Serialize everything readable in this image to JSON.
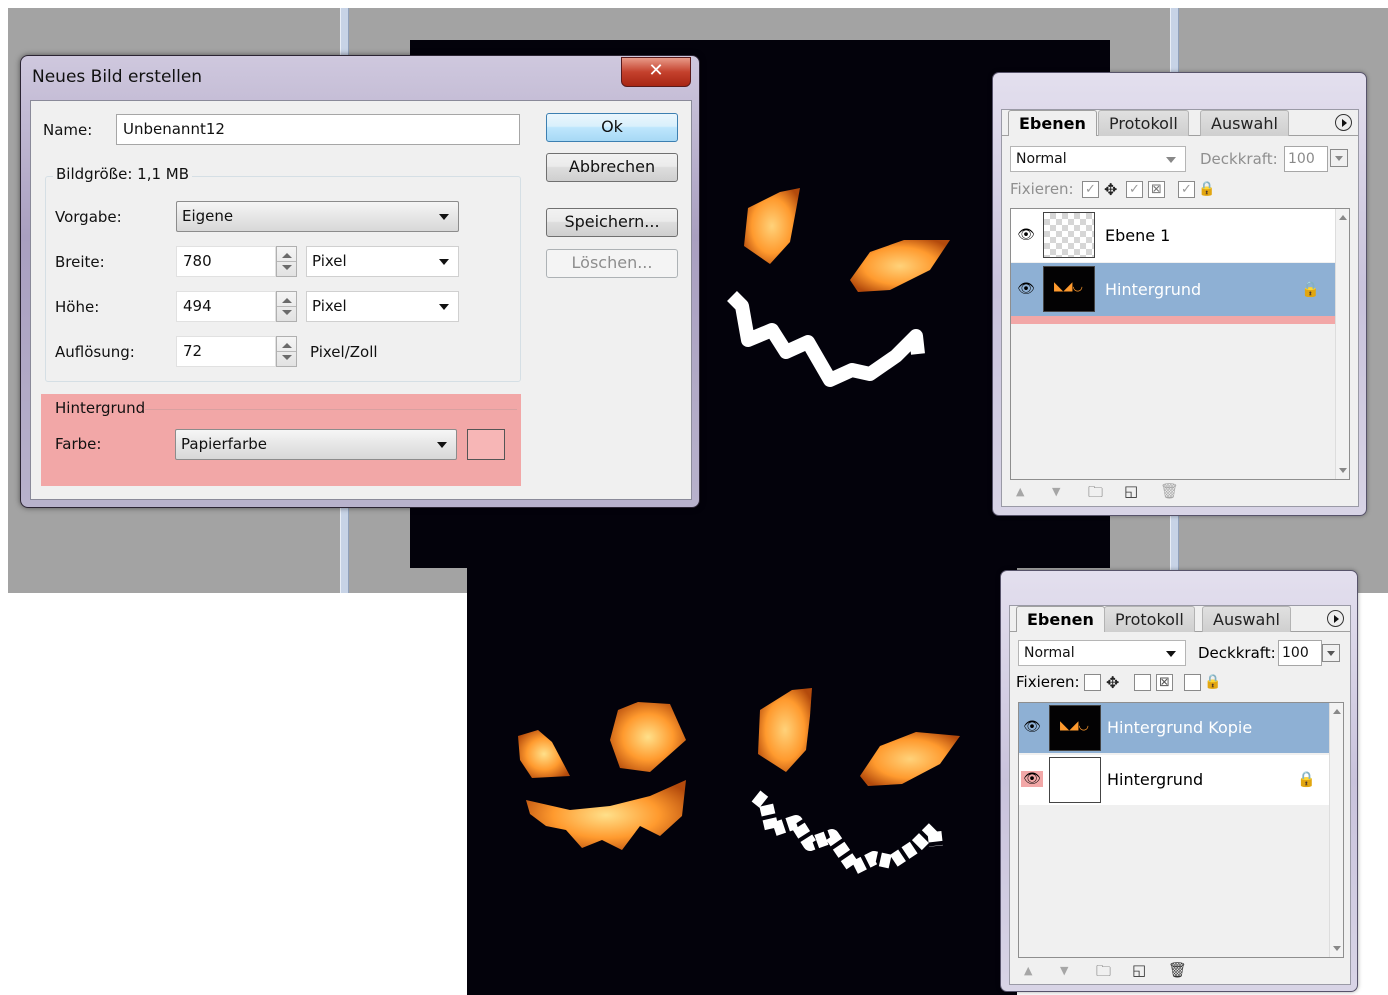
{
  "dialog": {
    "title": "Neues Bild erstellen",
    "close_glyph": "✕",
    "name_label": "Name:",
    "name_value": "Unbenannt12",
    "bildgroesse_label": "Bildgröße: 1,1 MB",
    "vorgabe_label": "Vorgabe:",
    "vorgabe_value": "Eigene",
    "breite_label": "Breite:",
    "breite_value": "780",
    "breite_unit": "Pixel",
    "hoehe_label": "Höhe:",
    "hoehe_value": "494",
    "hoehe_unit": "Pixel",
    "aufloesung_label": "Auflösung:",
    "aufloesung_value": "72",
    "aufloesung_unit": "Pixel/Zoll",
    "hintergrund_label": "Hintergrund",
    "farbe_label": "Farbe:",
    "farbe_value": "Papierfarbe",
    "swatch_color": "#f7b6b6",
    "buttons": {
      "ok": "Ok",
      "abbrechen": "Abbrechen",
      "speichern": "Speichern...",
      "loeschen": "Löschen..."
    }
  },
  "panel_top": {
    "tabs": [
      "Ebenen",
      "Protokoll",
      "Auswahl"
    ],
    "blend_mode": "Normal",
    "opacity_label": "Deckkraft:",
    "opacity_value": "100",
    "lock_label": "Fixieren:",
    "layers": [
      {
        "name": "Ebene 1",
        "selected": false,
        "thumb": "checker",
        "locked": false
      },
      {
        "name": "Hintergrund",
        "selected": true,
        "thumb": "black",
        "locked": true
      }
    ]
  },
  "panel_bottom": {
    "tabs": [
      "Ebenen",
      "Protokoll",
      "Auswahl"
    ],
    "blend_mode": "Normal",
    "opacity_label": "Deckkraft:",
    "opacity_value": "100",
    "lock_label": "Fixieren:",
    "layers": [
      {
        "name": "Hintergrund Kopie",
        "selected": true,
        "thumb": "black",
        "locked": false
      },
      {
        "name": "Hintergrund",
        "selected": false,
        "thumb": "blank",
        "locked": true
      }
    ]
  },
  "icons": {
    "eye": "👁",
    "lock": "🔒",
    "move": "✥",
    "up": "▲",
    "down": "▼",
    "folder": "🗀",
    "new_layer": "◱",
    "trash": "🗑"
  },
  "colors": {
    "canvas": "#03020b",
    "pumpkin_glow": "#ff9a2e",
    "selected_layer": "#8eb0d4",
    "highlight": "#f2a7a7"
  }
}
